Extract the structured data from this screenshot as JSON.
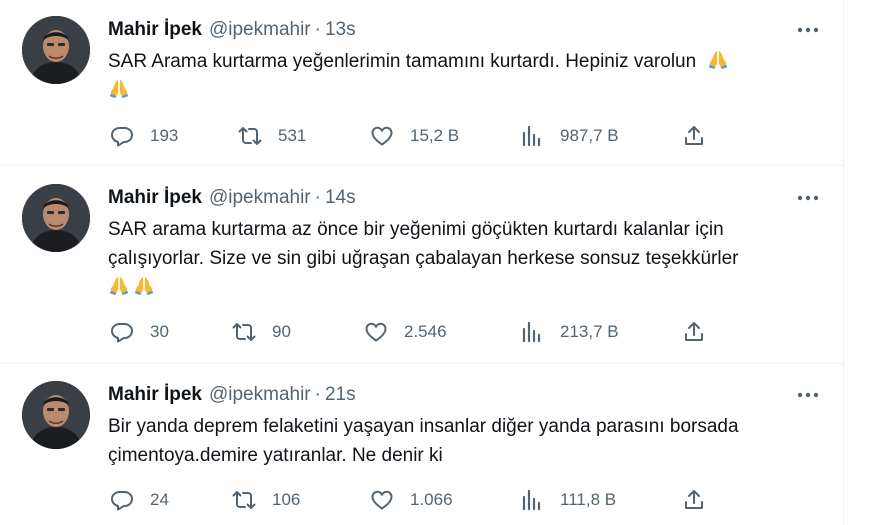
{
  "tweets": [
    {
      "author_name": "Mahir İpek",
      "handle": "@ipekmahir",
      "separator": "·",
      "time": "13s",
      "text": "SAR Arama kurtarma yeğenlerimin tamamını kurtardı. Hepiniz varolun",
      "emoji_count": 2,
      "stats": {
        "replies": "193",
        "retweets": "531",
        "likes": "15,2 B",
        "views": "987,7 B"
      }
    },
    {
      "author_name": "Mahir İpek",
      "handle": "@ipekmahir",
      "separator": "·",
      "time": "14s",
      "text": "SAR arama kurtarma az önce bir yeğenimi göçükten kurtardı kalanlar için çalışıyorlar. Size ve sin gibi uğraşan çabalayan herkese sonsuz teşekkürler",
      "emoji_count": 2,
      "stats": {
        "replies": "30",
        "retweets": "90",
        "likes": "2.546",
        "views": "213,7 B"
      }
    },
    {
      "author_name": "Mahir İpek",
      "handle": "@ipekmahir",
      "separator": "·",
      "time": "21s",
      "text": "Bir yanda deprem felaketini yaşayan insanlar diğer yanda parasını borsada çimentoya.demire yatıranlar. Ne denir ki",
      "emoji_count": 0,
      "stats": {
        "replies": "24",
        "retweets": "106",
        "likes": "1.066",
        "views": "111,8 B"
      }
    }
  ],
  "icons": {
    "more": "more-dots-icon",
    "reply": "reply-bubble-icon",
    "retweet": "retweet-arrows-icon",
    "like": "heart-icon",
    "views": "bar-chart-icon",
    "share": "share-upload-icon",
    "emoji": "folded-hands-emoji"
  },
  "colors": {
    "text_primary": "#0f1419",
    "text_secondary": "#536471",
    "divider": "#eff3f4",
    "emoji": "#f5b82e"
  }
}
